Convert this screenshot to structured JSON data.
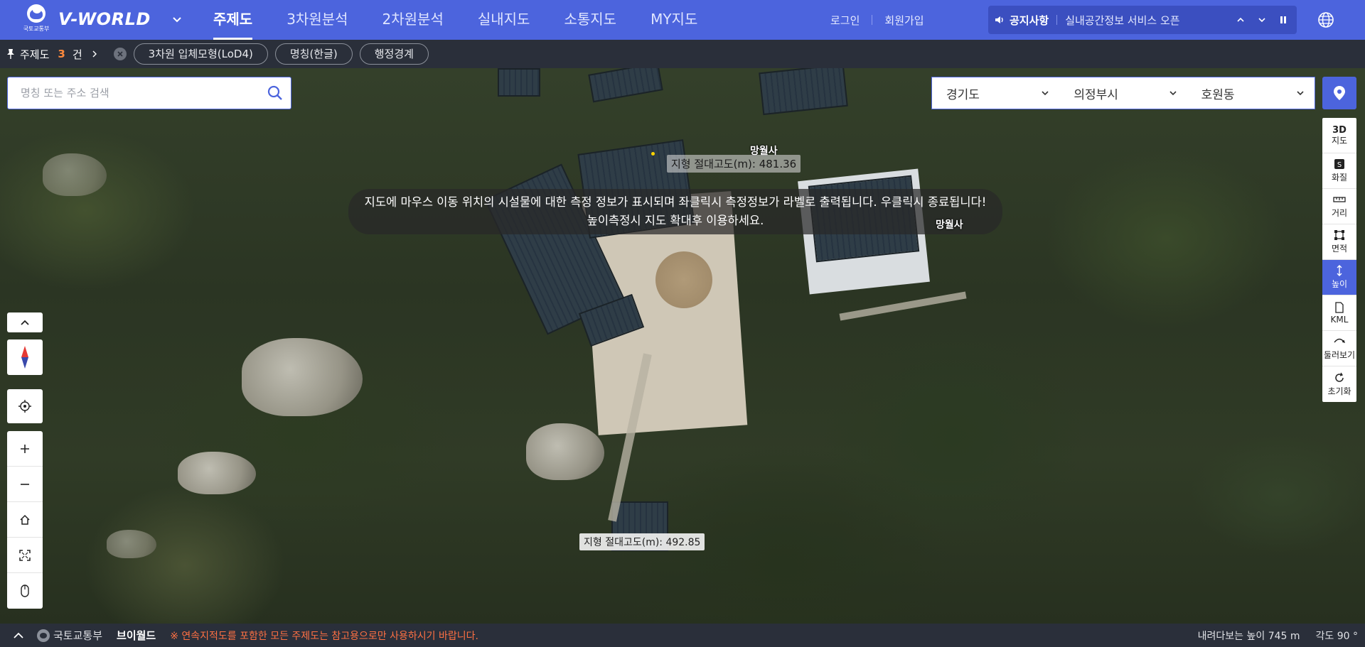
{
  "topnav": {
    "gov_logo_text": "국토교통부",
    "brand": "V-WORLD",
    "menu": [
      {
        "label": "주제도",
        "active": true
      },
      {
        "label": "3차원분석",
        "active": false
      },
      {
        "label": "2차원분석",
        "active": false
      },
      {
        "label": "실내지도",
        "active": false
      },
      {
        "label": "소통지도",
        "active": false
      },
      {
        "label": "MY지도",
        "active": false
      }
    ],
    "login": "로그인",
    "signup": "회원가입",
    "notice_label": "공지사항",
    "notice_message": "실내공간정보 서비스 오픈"
  },
  "toolbar": {
    "label": "주제도",
    "count": "3",
    "unit": "건",
    "chips": [
      "3차원 입체모형(LoD4)",
      "명칭(한글)",
      "행정경계"
    ]
  },
  "search": {
    "placeholder": "명칭 또는 주소 검색"
  },
  "region": {
    "province": "경기도",
    "city": "의정부시",
    "dong": "호원동"
  },
  "hint": {
    "line1": "지도에 마우스 이동 위치의 시설물에 대한 측정 정보가 표시되며 좌클릭시 측정정보가 라벨로 출력됩니다. 우클릭시 종료됩니다!",
    "line2": "높이측정시 지도 확대후 이용하세요."
  },
  "map": {
    "place_label_1": "망월사",
    "place_label_2": "망월사",
    "measure_1": "지형 절대고도(m): 481.36",
    "measure_2": "지형 절대고도(m): 492.85"
  },
  "tools": [
    {
      "label": "3D\n지도",
      "active": false
    },
    {
      "label": "화질",
      "active": false
    },
    {
      "label": "거리",
      "active": false
    },
    {
      "label": "면적",
      "active": false
    },
    {
      "label": "높이",
      "active": true
    },
    {
      "label": "KML",
      "active": false
    },
    {
      "label": "둘러보기",
      "active": false
    },
    {
      "label": "초기화",
      "active": false
    }
  ],
  "tool_labels": {
    "map3d_top": "3D",
    "map3d_bottom": "지도",
    "quality": "화질",
    "distance": "거리",
    "area": "면적",
    "height": "높이",
    "kml": "KML",
    "lookaround": "둘러보기",
    "reset": "초기화"
  },
  "bottom": {
    "org": "국토교통부",
    "vworld": "브이월드",
    "warning": "※ 연속지적도를 포함한 모든 주제도는 참고용으로만 사용하시기 바랍니다.",
    "view_height": "내려다보는 높이 745 m",
    "angle": "각도 90 °"
  },
  "colors": {
    "primary": "#4c64dd",
    "toolbar_bg": "#2a2f3a",
    "count_accent": "#ff8a3d",
    "warning": "#ff7043"
  }
}
